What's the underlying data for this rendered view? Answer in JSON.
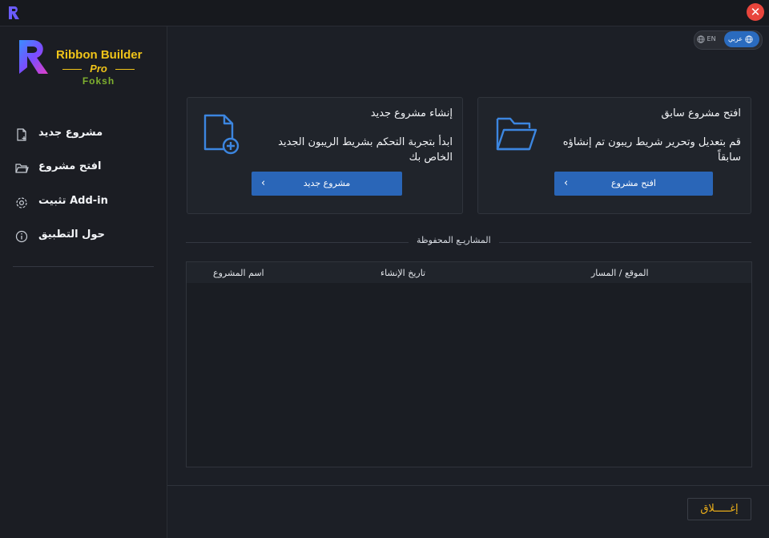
{
  "window": {
    "close_glyph": "✕"
  },
  "logo": {
    "title": "Ribbon Builder",
    "pro": "Pro",
    "brand": "Foksh"
  },
  "sidebar": {
    "items": [
      {
        "label": "مشروع جديد",
        "icon": "new-file-icon"
      },
      {
        "label": "افتح مشروع",
        "icon": "folder-icon"
      },
      {
        "label": "تثبيت Add-in",
        "icon": "gear-icon"
      },
      {
        "label": "حول التطبيق",
        "icon": "info-icon"
      }
    ]
  },
  "language": {
    "en": "EN",
    "ar": "عربي",
    "selected": "ar"
  },
  "cards": {
    "new_project": {
      "title": "إنشاء مشروع جديد",
      "desc": "ابدأ بتجربة التحكم بشريط الريبون الجديد الخاص بك",
      "button": "مشروع جديد"
    },
    "open_project": {
      "title": "افتح مشروع سابق",
      "desc": "قم بتعديل وتحرير شريط ريبون تم إنشاؤه سابقاً",
      "button": "افتح مشروع"
    }
  },
  "saved": {
    "title": "المشاريـع المحفوظة",
    "columns": [
      "الموقع / المسار",
      "تاريخ الإنشاء",
      "اسم المشروع"
    ],
    "rows": []
  },
  "footer": {
    "close_label": "إغـــــلاق"
  },
  "colors": {
    "accent": "#2a66b8",
    "gold": "#f0c419",
    "close_text": "#f0b21a",
    "danger": "#e8453c"
  }
}
